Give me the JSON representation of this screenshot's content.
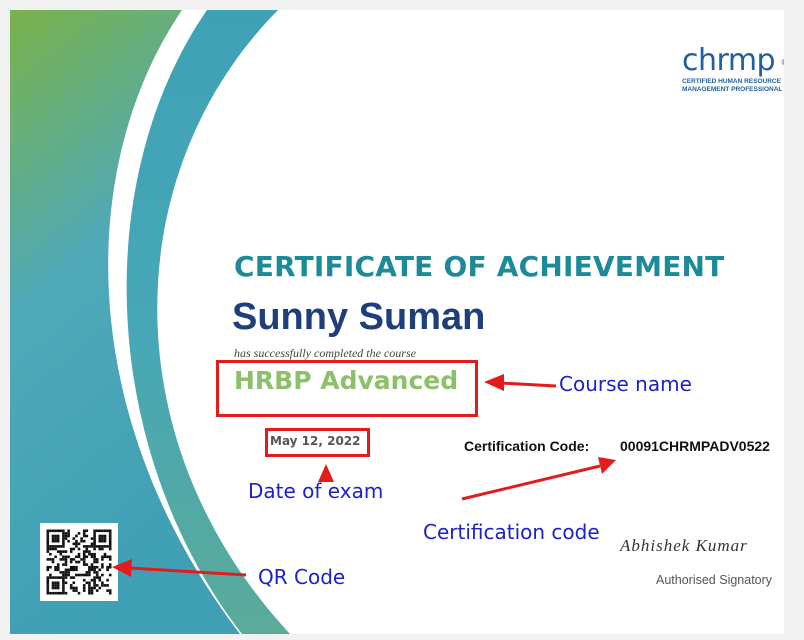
{
  "certificate": {
    "logo": {
      "wordmark": "chrmp",
      "registered": "®",
      "line1": "CERTIFIED HUMAN RESOURCE",
      "line2": "MANAGEMENT PROFESSIONAL"
    },
    "title": "CERTIFICATE OF ACHIEVEMENT",
    "recipient_name": "Sunny Suman",
    "completed_text": "has successfully completed the course",
    "course_name": "HRBP Advanced",
    "exam_date": "May 12, 2022",
    "certification_code_label": "Certification Code:",
    "certification_code_value": "00091CHRMPADV0522",
    "signature": "Abhishek Kumar",
    "signatory_label": "Authorised Signatory"
  },
  "annotations": {
    "course_name": "Course name",
    "date_of_exam": "Date of exam",
    "certification_code": "Certification code",
    "qr_code": "QR Code"
  },
  "colors": {
    "title": "#1d8a9a",
    "name": "#1f3f7a",
    "course": "#8cc06a",
    "annotation_text": "#1c22c9",
    "annotation_marks": "#e41b1b"
  }
}
